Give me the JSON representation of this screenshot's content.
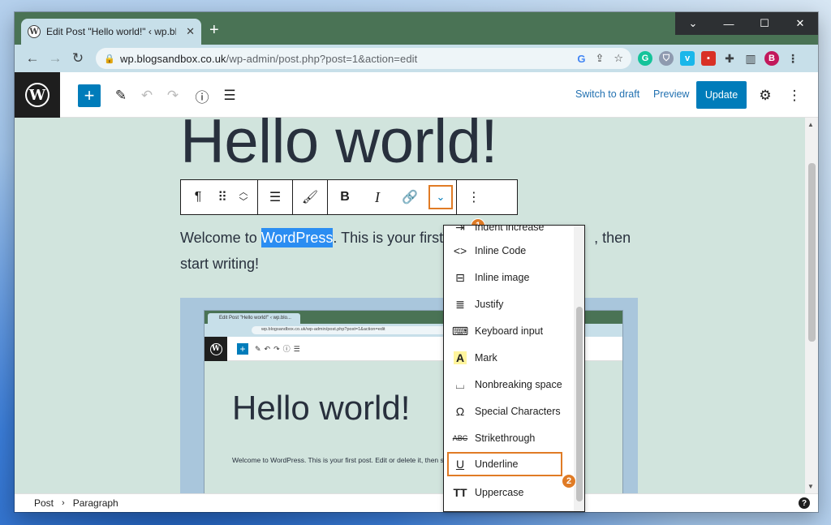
{
  "browser": {
    "tab_title": "Edit Post \"Hello world!\" ‹ wp.blogs",
    "url_host": "wp.blogsandbox.co.uk",
    "url_path": "/wp-admin/post.php?post=1&action=edit",
    "profile_initial": "B"
  },
  "wp_header": {
    "switch_to_draft": "Switch to draft",
    "preview": "Preview",
    "update": "Update"
  },
  "post": {
    "title": "Hello world!",
    "paragraph_before": "Welcome to ",
    "paragraph_selected": "WordPress",
    "paragraph_after_line1": ". This is your first",
    "paragraph_tail_line1": ", then",
    "paragraph_line2": "start writing!"
  },
  "embedded": {
    "tab_title": "Edit Post \"Hello world!\" ‹ wp.blo...",
    "url": "wp.blogsandbox.co.uk/wp-admin/post.php?post=1&action=edit",
    "title": "Hello world!",
    "paragraph": "Welcome to WordPress. This is your first post. Edit or delete it, then start writing!"
  },
  "format_menu": {
    "items": [
      {
        "label": "Indent increase",
        "icon": "indent-icon"
      },
      {
        "label": "Inline Code",
        "icon": "code-icon"
      },
      {
        "label": "Inline image",
        "icon": "image-icon"
      },
      {
        "label": "Justify",
        "icon": "justify-icon"
      },
      {
        "label": "Keyboard input",
        "icon": "keyboard-icon"
      },
      {
        "label": "Mark",
        "icon": "mark-icon"
      },
      {
        "label": "Nonbreaking space",
        "icon": "nbsp-icon"
      },
      {
        "label": "Special Characters",
        "icon": "omega-icon"
      },
      {
        "label": "Strikethrough",
        "icon": "strikethrough-icon"
      },
      {
        "label": "Underline",
        "icon": "underline-icon"
      },
      {
        "label": "Uppercase",
        "icon": "uppercase-icon"
      }
    ]
  },
  "annotations": {
    "step1": "1",
    "step2": "2"
  },
  "footer": {
    "crumb1": "Post",
    "crumb2": "Paragraph"
  },
  "colors": {
    "wp_blue": "#007cba",
    "highlight_orange": "#e07b25",
    "canvas_bg": "#d1e4dd",
    "selection": "#2b8df2"
  }
}
